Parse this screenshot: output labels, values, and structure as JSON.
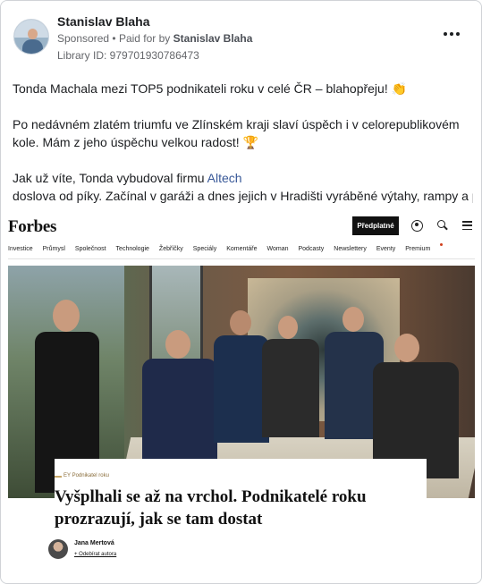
{
  "post": {
    "author": "Stanislav Blaha",
    "sponsored_label": "Sponsored",
    "separator": "•",
    "paid_for_label": "Paid for by",
    "payer": "Stanislav Blaha",
    "library_id": "Library ID: 979701930786473",
    "paragraph1": "Tonda Machala mezi TOP5 podnikateli roku v celé ČR – blahopřeju! 👏",
    "paragraph2": "Po nedávném zlatém triumfu ve Zlínském kraji slaví úspěch i v celorepublikovém kole. Mám z jeho úspěchu velkou radost! 🏆",
    "paragraph3_before": "Jak už víte, Tonda vybudoval firmu ",
    "paragraph3_link": "Altech",
    "paragraph3_after": " doslova od píky. Začínal v garáži a dnes jejich v Hradišti vyráběné výtahy, rampy a plošiny pro lidi s handicapem najdete p…"
  },
  "article": {
    "logo": "Forbes",
    "subscribe_label": "Předplatné",
    "nav": [
      "Investice",
      "Průmysl",
      "Společnost",
      "Technologie",
      "Žebříčky",
      "Speciály",
      "Komentáře",
      "Woman",
      "Podcasty",
      "Newslettery",
      "Eventy",
      "Premium"
    ],
    "kicker": "EY Podnikatel roku",
    "headline": "Vyšplhali se až na vrchol. Podnikatelé roku prozrazují, jak se tam dostat",
    "byline_name": "Jana Mertová",
    "follow_label": "+ Odebírat autora"
  },
  "colors": {
    "link": "#385898",
    "muted": "#65676b",
    "subscribe_bg": "#111111"
  }
}
